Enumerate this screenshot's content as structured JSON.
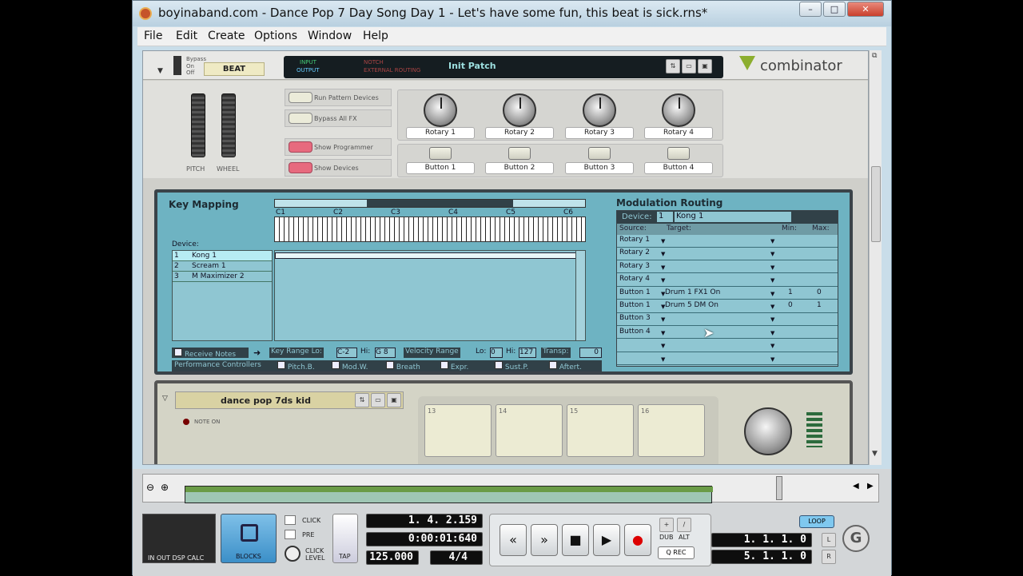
{
  "window": {
    "title": "boyinaband.com - Dance Pop 7 Day Song Day 1 - Let's have some fun, this beat is sick.rns*",
    "min": "–",
    "max": "□",
    "close": "✕"
  },
  "menu": [
    "File",
    "Edit",
    "Create",
    "Options",
    "Window",
    "Help"
  ],
  "combinator": {
    "bypass": "Bypass",
    "on": "On",
    "off": "Off",
    "device_name": "BEAT",
    "input": "INPUT",
    "output": "OUTPUT",
    "routing_a": "NOTCH",
    "routing_b": "EXTERNAL ROUTING",
    "patch": "Init Patch",
    "logo": "combinator",
    "pitch": "PITCH",
    "wheel": "WHEEL",
    "options": [
      "Run Pattern Devices",
      "Bypass All FX",
      "Show Programmer",
      "Show Devices"
    ],
    "rotaries": [
      "Rotary 1",
      "Rotary 2",
      "Rotary 3",
      "Rotary 4"
    ],
    "buttons": [
      "Button 1",
      "Button 2",
      "Button 3",
      "Button 4"
    ]
  },
  "programmer": {
    "key_mapping": "Key Mapping",
    "device_label": "Device:",
    "octaves": [
      "C1",
      "C2",
      "C3",
      "C4",
      "C5",
      "C6"
    ],
    "devices": [
      {
        "n": "1",
        "name": "Kong 1"
      },
      {
        "n": "2",
        "name": "Scream 1"
      },
      {
        "n": "3",
        "name": "M Maximizer 2"
      }
    ],
    "receive_notes": "Receive Notes",
    "key_range": "Key Range Lo:",
    "lo": "C-2",
    "hi_label": "Hi:",
    "hi": "G 8",
    "velocity": "Velocity Range",
    "vlo_label": "Lo:",
    "vlo": "0",
    "vhi_label": "Hi:",
    "vhi": "127",
    "transp": "Transp:",
    "transp_val": "0",
    "perf": "Performance Controllers",
    "perf_items": [
      "Pitch.B.",
      "Mod.W.",
      "Breath",
      "Expr.",
      "Sust.P.",
      "Aftert."
    ],
    "modulation": {
      "title": "Modulation Routing",
      "device": "Device:",
      "dev_num": "1",
      "dev_name": "Kong 1",
      "cols": [
        "Source:",
        "Target:",
        "Min:",
        "Max:"
      ],
      "rows": [
        {
          "src": "Rotary 1",
          "tgt": "",
          "min": "",
          "max": ""
        },
        {
          "src": "Rotary 2",
          "tgt": "",
          "min": "",
          "max": ""
        },
        {
          "src": "Rotary 3",
          "tgt": "",
          "min": "",
          "max": ""
        },
        {
          "src": "Rotary 4",
          "tgt": "",
          "min": "",
          "max": ""
        },
        {
          "src": "Button 1",
          "tgt": "Drum 1 FX1 On",
          "min": "1",
          "max": "0"
        },
        {
          "src": "Button 1",
          "tgt": "Drum 5 DM On",
          "min": "0",
          "max": "1"
        },
        {
          "src": "Button 3",
          "tgt": "",
          "min": "",
          "max": ""
        },
        {
          "src": "Button 4",
          "tgt": "",
          "min": "",
          "max": ""
        },
        {
          "src": "",
          "tgt": "",
          "min": "",
          "max": ""
        },
        {
          "src": "",
          "tgt": "",
          "min": "",
          "max": ""
        }
      ]
    }
  },
  "kong": {
    "patch": "dance pop 7ds kid",
    "note_on": "NOTE ON",
    "pads": [
      "13",
      "14",
      "15",
      "16"
    ]
  },
  "transport": {
    "in_out": "IN OUT DSP CALC",
    "blocks": "BLOCKS",
    "click": "CLICK",
    "pre": "PRE",
    "click_level": "CLICK LEVEL",
    "tap": "TAP",
    "bars": "1. 4. 2.159",
    "time": "0:00:01:640",
    "tempo": "125.000",
    "sig": "4/4",
    "dub": "DUB",
    "alt": "ALT",
    "qrec": "Q REC",
    "loop": "LOOP",
    "left_loc": "1. 1. 1.   0",
    "right_loc": "5. 1. 1.   0",
    "L": "L",
    "R": "R"
  }
}
